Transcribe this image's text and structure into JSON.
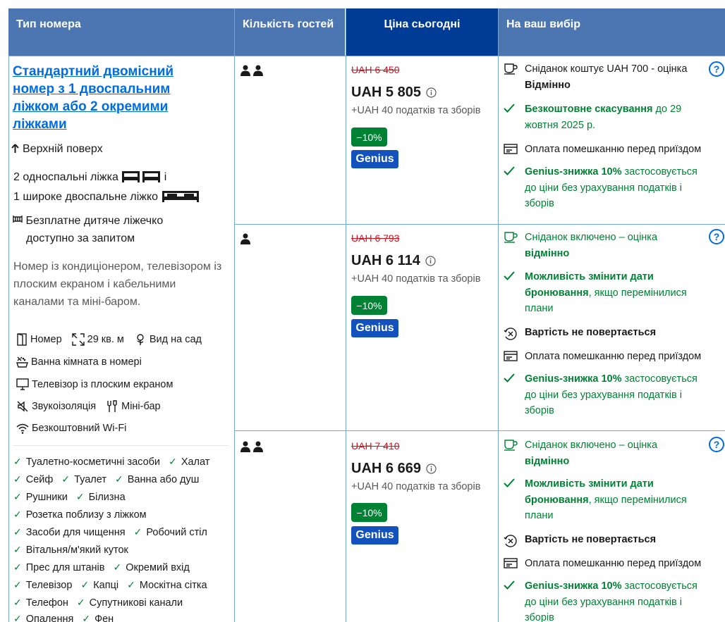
{
  "header": {
    "room_type": "Тип номера",
    "guests": "Кількість гостей",
    "price_today": "Ціна сьогодні",
    "your_choice": "На ваш вибір"
  },
  "room": {
    "title": "Стандартний двомісний номер з 1 двоспальним ліжком або 2 окремими ліжками",
    "floor": "Верхній поверх",
    "beds_line1": "2 односпальні ліжка",
    "beds_and": "і",
    "beds_line2": "1 широке двоспальне ліжко",
    "crib_line1": "Безплатне дитяче ліжечко",
    "crib_line2": "доступно за запитом",
    "description": "Номер із кондиціонером, телевізором із плоским екраном і кабельними каналами та міні-баром.",
    "facilities": {
      "room": "Номер",
      "size": "29 кв. м",
      "view": "Вид на сад",
      "bathroom": "Ванна кімната в номері",
      "tv": "Телевізор із плоским екраном",
      "soundproof": "Звукоізоляція",
      "minibar": "Міні-бар",
      "wifi": "Безкоштовний Wi-Fi"
    },
    "amenities": [
      [
        "Туалетно-косметичні засоби",
        "Халат"
      ],
      [
        "Сейф",
        "Туалет",
        "Ванна або душ"
      ],
      [
        "Рушники",
        "Білизна"
      ],
      [
        "Розетка поблизу з ліжком"
      ],
      [
        "Засоби для чищення",
        "Робочий стіл"
      ],
      [
        "Вітальня/м'який куток"
      ],
      [
        "Прес для штанів",
        "Окремий вхід"
      ],
      [
        "Телевізор",
        "Капці",
        "Москітна сітка"
      ],
      [
        "Телефон",
        "Супутникові канали"
      ],
      [
        "Опалення",
        "Фен"
      ]
    ]
  },
  "offers": [
    {
      "old_price": "UAH 6 450",
      "price": "UAH 5 805",
      "tax": "+UAH 40 податків та зборів",
      "discount": "−10%",
      "genius": "Genius",
      "breakfast_text": "Сніданок коштує UAH 700 - оцінка",
      "breakfast_rating": "Відмінно",
      "cancel_bold": "Безкоштовне скасування",
      "cancel_rest": " до 29 жовтня 2025 р.",
      "payment": "Оплата помешканню перед приїздом",
      "genius_bold": "Genius-знижка 10%",
      "genius_rest": " застосовується до ціни без урахування податків і зборів"
    },
    {
      "old_price": "UAH 6 793",
      "price": "UAH 6 114",
      "tax": "+UAH 40 податків та зборів",
      "discount": "−10%",
      "genius": "Genius",
      "breakfast_text": "Сніданок включено – оцінка",
      "breakfast_rating": "відмінно",
      "change_bold": "Можливість змінити дати бронювання",
      "change_rest": ", якщо перемінилися плани",
      "nonrefund": "Вартість не повертається",
      "payment": "Оплата помешканню перед приїздом",
      "genius_bold": "Genius-знижка 10%",
      "genius_rest": " застосовується до ціни без урахування податків і зборів"
    },
    {
      "old_price": "UAH 7 410",
      "price": "UAH 6 669",
      "tax": "+UAH 40 податків та зборів",
      "discount": "−10%",
      "genius": "Genius",
      "breakfast_text": "Сніданок включено – оцінка",
      "breakfast_rating": "відмінно",
      "change_bold": "Можливість змінити дати бронювання",
      "change_rest": ", якщо перемінилися плани",
      "nonrefund": "Вартість не повертається",
      "payment": "Оплата помешканню перед приїздом",
      "genius_bold": "Genius-знижка 10%",
      "genius_rest": " застосовується до ціни без урахування податків і зборів"
    }
  ],
  "help_symbol": "?",
  "icons": {
    "person": "person-icon",
    "info": "info-icon",
    "check": "check-icon",
    "cup": "coffee-cup-icon",
    "card": "payment-card-icon",
    "nonrefund": "no-refund-icon"
  },
  "colors": {
    "header": "#4c76b2",
    "price_header": "#003b95",
    "link": "#006ce4",
    "green": "#008234",
    "strike_red": "#d4111e",
    "genius_blue": "#1351bd",
    "grid": "#76a5de"
  }
}
